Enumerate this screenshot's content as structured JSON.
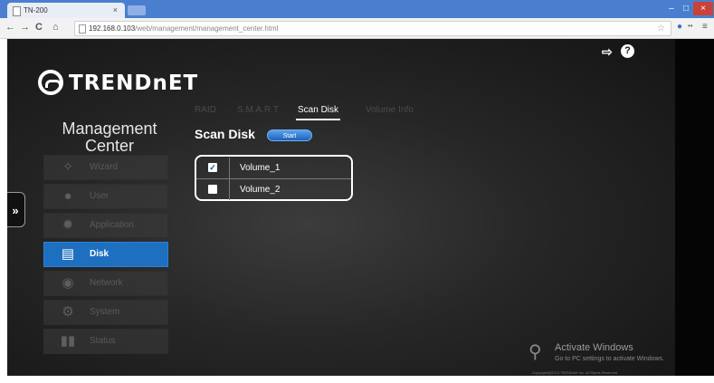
{
  "browser": {
    "tab_title": "TN-200",
    "tab_close": "×",
    "url_host": "192.168.0.103",
    "url_path": "/web/management/management_center.html",
    "window_controls": [
      "–",
      "□",
      "×"
    ]
  },
  "header": {
    "brand": "TRENDnET",
    "logout_icon": "logout-icon",
    "help_icon": "help-icon"
  },
  "sidebar": {
    "title_line1": "Management",
    "title_line2": "Center",
    "items": [
      {
        "label": "Wizard",
        "icon": "wizard-icon",
        "active": false
      },
      {
        "label": "User",
        "icon": "user-icon",
        "active": false
      },
      {
        "label": "Application",
        "icon": "application-icon",
        "active": false
      },
      {
        "label": "Disk",
        "icon": "disk-icon",
        "active": true
      },
      {
        "label": "Network",
        "icon": "network-icon",
        "active": false
      },
      {
        "label": "System",
        "icon": "system-icon",
        "active": false
      },
      {
        "label": "Status",
        "icon": "status-icon",
        "active": false
      }
    ]
  },
  "tabs": [
    {
      "label": "RAID",
      "active": false
    },
    {
      "label": "S.M.A.R.T",
      "active": false
    },
    {
      "label": "Scan Disk",
      "active": true
    },
    {
      "label": "Volume Info",
      "active": false
    }
  ],
  "scan_disk": {
    "title": "Scan Disk",
    "start_label": "Start",
    "volumes": [
      {
        "name": "Volume_1",
        "checked": true
      },
      {
        "name": "Volume_2",
        "checked": false
      }
    ]
  },
  "watermark": {
    "title": "Activate Windows",
    "subtitle": "Go to PC settings to activate Windows.",
    "copyright": "Copyright@2013 TRENDnet Inc. All Rights Reserved."
  },
  "colors": {
    "accent": "#1f6fc0",
    "chrome_blue": "#4a7fd0",
    "background": "#262626"
  }
}
